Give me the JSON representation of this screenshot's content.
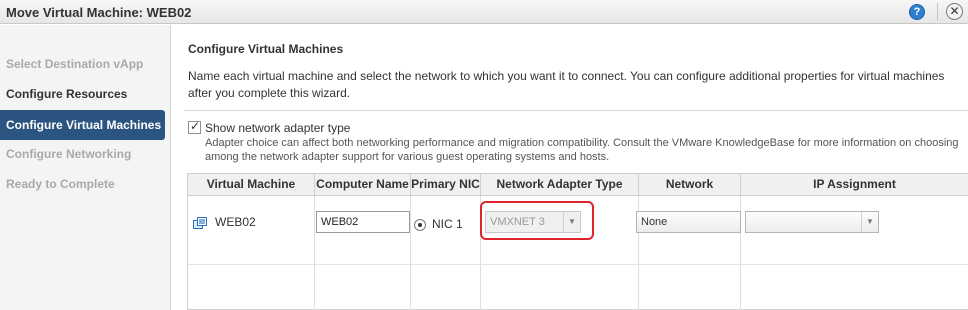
{
  "window": {
    "title": "Move Virtual Machine: WEB02",
    "help_icon": "?",
    "close_icon": "✕"
  },
  "sidebar": {
    "steps": [
      {
        "label": "Select Destination vApp",
        "state": "disabled"
      },
      {
        "label": "Configure Resources",
        "state": "done"
      },
      {
        "label": "Configure Virtual Machines",
        "state": "active"
      },
      {
        "label": "Configure Networking",
        "state": "disabled"
      },
      {
        "label": "Ready to Complete",
        "state": "disabled"
      }
    ]
  },
  "main": {
    "title": "Configure Virtual Machines",
    "description": "Name each virtual machine and select the network to which you want it to connect. You can configure additional properties for virtual machines after you complete this wizard.",
    "show_adapter": {
      "label": "Show network adapter type",
      "checked": true,
      "check_mark": "✓",
      "hint": "Adapter choice can affect both networking performance and migration compatibility. Consult the VMware KnowledgeBase for more information on choosing among the network adapter support for various guest operating systems and hosts."
    },
    "table": {
      "columns": [
        "Virtual Machine",
        "Computer Name",
        "Primary NIC",
        "Network Adapter Type",
        "Network",
        "IP Assignment"
      ],
      "rows": [
        {
          "vm": "WEB02",
          "computer_name": "WEB02",
          "primary_nic": "NIC 1",
          "adapter_type": "VMXNET 3",
          "network": "None",
          "ip_assignment": ""
        }
      ]
    },
    "colors": {
      "active_step": "#2b5580",
      "highlight": "#e0242b",
      "help_icon": "#2f7fd0"
    },
    "dropdown_arrow": "▼"
  }
}
